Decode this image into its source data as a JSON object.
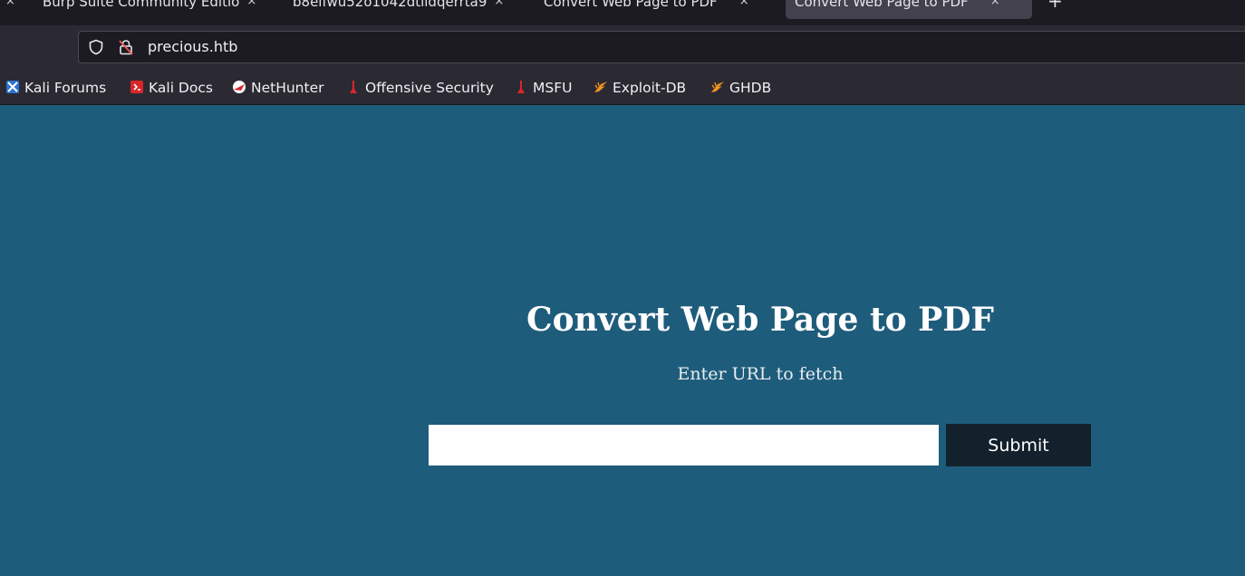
{
  "tabs": [
    {
      "title": "Burp Suite Community Editio",
      "close": "×"
    },
    {
      "title": "b8eifwu52o1042dtildqerrta9",
      "close": "×"
    },
    {
      "title": "Convert Web Page to PDF",
      "close": "×"
    },
    {
      "title": "Convert Web Page to PDF",
      "close": "×",
      "active": true
    }
  ],
  "first_tab_close": "×",
  "new_tab": "+",
  "address_bar": {
    "url": "precious.htb"
  },
  "bookmarks": [
    {
      "label": "Kali Forums",
      "icon": "kali-forums-icon"
    },
    {
      "label": "Kali Docs",
      "icon": "kali-docs-icon"
    },
    {
      "label": "NetHunter",
      "icon": "nethunter-icon"
    },
    {
      "label": "Offensive Security",
      "icon": "offsec-icon"
    },
    {
      "label": "MSFU",
      "icon": "msfu-icon"
    },
    {
      "label": "Exploit-DB",
      "icon": "exploit-db-icon"
    },
    {
      "label": "GHDB",
      "icon": "ghdb-icon"
    }
  ],
  "page": {
    "heading": "Convert Web Page to PDF",
    "subheading": "Enter URL to fetch",
    "url_input": {
      "value": "",
      "placeholder": ""
    },
    "submit_label": "Submit"
  },
  "colors": {
    "page_background": "#1e5c7b",
    "submit_button": "#12212c",
    "chrome_dark": "#1c1b22",
    "chrome_toolbar": "#2b2a33"
  }
}
